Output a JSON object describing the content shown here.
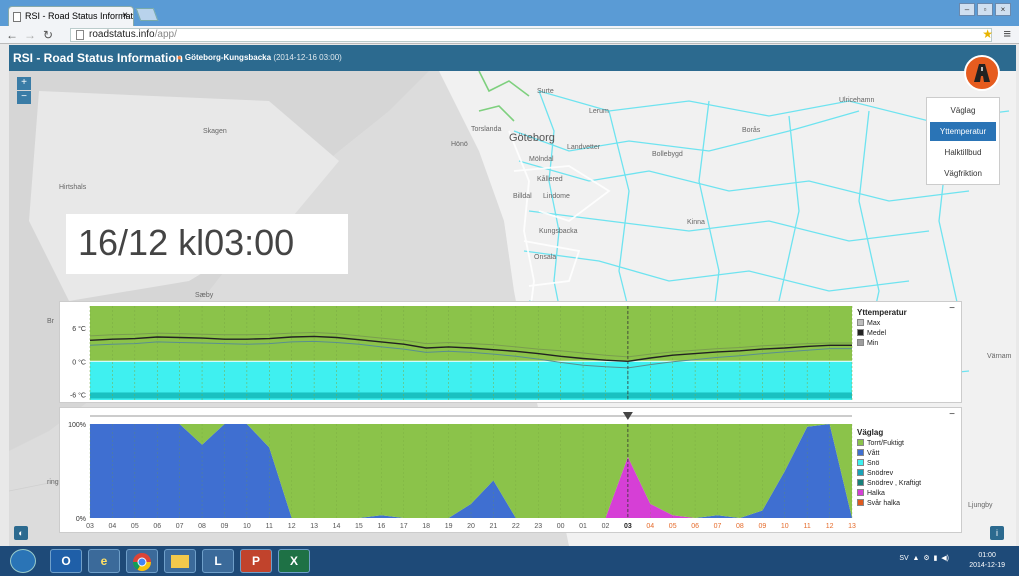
{
  "browser": {
    "tab_title": "RSI - Road Status Informat",
    "url_host": "roadstatus.info",
    "url_path": "/app/"
  },
  "app": {
    "title": "RSI - Road Status Information",
    "location": "Göteborg-Kungsbacka",
    "location_date": "(2014-12-16 03:00)"
  },
  "map": {
    "labels": {
      "skagen": "Skagen",
      "hirtshals": "Hirtshals",
      "saeby": "Sæby",
      "br": "Br",
      "ring": "ring",
      "goteborg": "Göteborg",
      "torslanda": "Torslanda",
      "molndal": "Mölndal",
      "kallered": "Kållered",
      "lindome": "Lindome",
      "kungsbacka": "Kungsbacka",
      "onsala": "Onsala",
      "lerum": "Lerum",
      "surte": "Surte",
      "landvetter": "Landvetter",
      "bollebygd": "Bollebygd",
      "borås": "Borås",
      "ulricehamn": "Ulricehamn",
      "kinna": "Kinna",
      "varnam": "Värnam",
      "ljungby": "Ljungby",
      "hono": "Hönö",
      "billdal": "Billdal"
    },
    "layer_buttons": [
      "Väglag",
      "Yttemperatur",
      "Halktillbud",
      "Vägfriktion"
    ],
    "active_layer": "Yttemperatur",
    "time_display": "16/12 kl03:00",
    "zoom_in": "+",
    "zoom_out": "−"
  },
  "temp_chart": {
    "legend_title": "Yttemperatur",
    "legend": [
      {
        "label": "Max",
        "color": "#bdbdbd"
      },
      {
        "label": "Medel",
        "color": "#222222"
      },
      {
        "label": "Min",
        "color": "#9e9e9e"
      }
    ],
    "y_ticks": [
      "6 °C",
      "0 °C",
      "-6 °C"
    ],
    "collapse": "−"
  },
  "road_chart": {
    "legend_title": "Väglag",
    "legend": [
      {
        "label": "Torrt/Fuktigt",
        "color": "#8bc34a"
      },
      {
        "label": "Vått",
        "color": "#3f6fd1"
      },
      {
        "label": "Snö",
        "color": "#3ff0f0"
      },
      {
        "label": "Snödrev",
        "color": "#1aa3b8"
      },
      {
        "label": "Snödrev , Kraftigt",
        "color": "#17807a"
      },
      {
        "label": "Halka",
        "color": "#d63fd6"
      },
      {
        "label": "Svår halka",
        "color": "#e05a1f"
      }
    ],
    "y_ticks": [
      "100%",
      "0%"
    ],
    "x_ticks": [
      "03",
      "04",
      "05",
      "06",
      "07",
      "08",
      "09",
      "10",
      "11",
      "12",
      "13",
      "14",
      "15",
      "16",
      "17",
      "18",
      "19",
      "20",
      "21",
      "22",
      "23",
      "00",
      "01",
      "02",
      "03",
      "04",
      "05",
      "06",
      "07",
      "08",
      "09",
      "10",
      "11",
      "12",
      "13"
    ],
    "current_tick": "03",
    "collapse": "−"
  },
  "chart_data": [
    {
      "type": "line",
      "title": "Yttemperatur",
      "ylim": [
        -7,
        10
      ],
      "x": [
        "03",
        "04",
        "05",
        "06",
        "07",
        "08",
        "09",
        "10",
        "11",
        "12",
        "13",
        "14",
        "15",
        "16",
        "17",
        "18",
        "19",
        "20",
        "21",
        "22",
        "23",
        "00",
        "01",
        "02",
        "03",
        "04",
        "05",
        "06",
        "07",
        "08",
        "09",
        "10",
        "11",
        "12",
        "13"
      ],
      "series": [
        {
          "name": "Max",
          "values": [
            4.6,
            4.8,
            4.9,
            5.1,
            5.0,
            4.9,
            4.8,
            4.8,
            4.9,
            5.1,
            5.2,
            5.0,
            4.6,
            4.2,
            3.8,
            3.2,
            3.4,
            3.2,
            3.0,
            2.6,
            2.2,
            1.9,
            1.5,
            1.1,
            0.8,
            1.3,
            1.7,
            2.0,
            2.3,
            2.5,
            2.8,
            3.0,
            3.2,
            3.3,
            3.3
          ]
        },
        {
          "name": "Medel",
          "values": [
            3.8,
            4.0,
            4.1,
            4.4,
            4.3,
            4.2,
            4.0,
            4.0,
            4.1,
            4.4,
            4.5,
            4.3,
            3.9,
            3.5,
            3.1,
            2.4,
            2.6,
            2.4,
            2.1,
            1.8,
            1.4,
            0.9,
            0.5,
            0.2,
            0.0,
            0.6,
            1.1,
            1.4,
            1.7,
            1.9,
            2.2,
            2.4,
            2.7,
            2.9,
            2.9
          ]
        },
        {
          "name": "Min",
          "values": [
            2.9,
            3.1,
            3.2,
            3.5,
            3.4,
            3.3,
            3.2,
            3.1,
            3.2,
            3.5,
            3.6,
            3.4,
            3.1,
            2.6,
            2.2,
            1.6,
            1.8,
            1.6,
            1.3,
            0.9,
            0.4,
            -0.2,
            -0.7,
            -1.0,
            -1.2,
            -0.6,
            -0.1,
            0.3,
            0.7,
            1.0,
            1.4,
            1.7,
            2.0,
            2.3,
            2.3
          ]
        }
      ]
    },
    {
      "type": "area",
      "title": "Väglag",
      "ylim": [
        0,
        100
      ],
      "x": [
        "03",
        "04",
        "05",
        "06",
        "07",
        "08",
        "09",
        "10",
        "11",
        "12",
        "13",
        "14",
        "15",
        "16",
        "17",
        "18",
        "19",
        "20",
        "21",
        "22",
        "23",
        "00",
        "01",
        "02",
        "03",
        "04",
        "05",
        "06",
        "07",
        "08",
        "09",
        "10",
        "11",
        "12",
        "13"
      ],
      "series": [
        {
          "name": "Vått",
          "values": [
            100,
            100,
            100,
            100,
            100,
            78,
            100,
            100,
            75,
            0,
            0,
            0,
            0,
            3,
            0,
            0,
            0,
            15,
            40,
            0,
            0,
            0,
            0,
            0,
            0,
            0,
            0,
            0,
            3,
            0,
            8,
            50,
            97,
            100,
            0
          ]
        },
        {
          "name": "Halka",
          "values": [
            0,
            0,
            0,
            0,
            0,
            0,
            0,
            0,
            0,
            0,
            0,
            0,
            0,
            0,
            0,
            0,
            0,
            0,
            0,
            0,
            0,
            0,
            0,
            0,
            65,
            15,
            3,
            0,
            0,
            0,
            0,
            0,
            0,
            0,
            0
          ]
        },
        {
          "name": "Torrt/Fuktigt",
          "values": [
            0,
            0,
            0,
            0,
            0,
            22,
            0,
            0,
            25,
            100,
            100,
            100,
            100,
            97,
            100,
            100,
            100,
            85,
            60,
            100,
            100,
            100,
            100,
            100,
            35,
            85,
            97,
            100,
            97,
            100,
            92,
            50,
            3,
            0,
            100
          ]
        }
      ]
    }
  ],
  "taskbar": {
    "apps": [
      "O",
      "e",
      "",
      "",
      "L",
      "P",
      "X"
    ],
    "lang": "SV",
    "time": "01:00",
    "date": "2014-12-19"
  }
}
